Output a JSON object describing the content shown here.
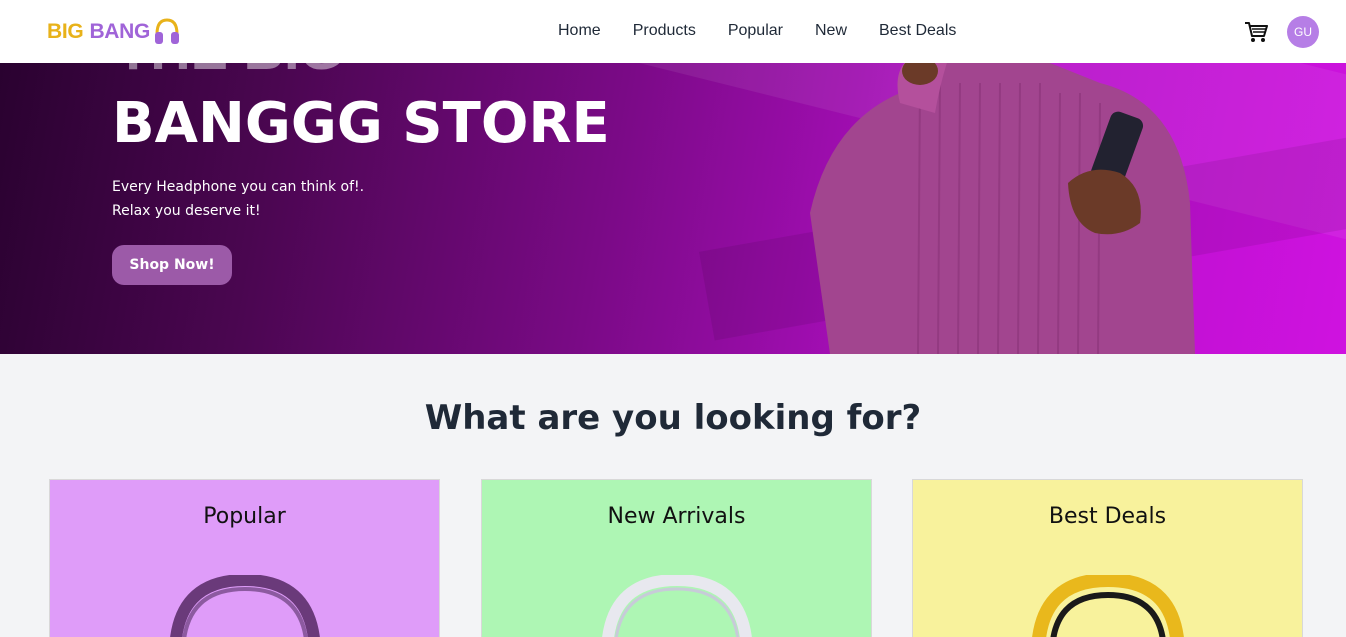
{
  "logo": {
    "part1": "BIG",
    "part2": "BANG"
  },
  "nav": {
    "links": [
      "Home",
      "Products",
      "Popular",
      "New",
      "Best Deals"
    ],
    "avatar_initials": "GU"
  },
  "hero": {
    "ghost_text": "THE BIG",
    "title": "BANGGG STORE",
    "subtitle_line1": "Every Headphone you can think of!.",
    "subtitle_line2": "Relax you deserve it!",
    "cta_label": "Shop Now!"
  },
  "section": {
    "title": "What are you looking for?",
    "cards": [
      {
        "title": "Popular"
      },
      {
        "title": "New Arrivals"
      },
      {
        "title": "Best Deals"
      }
    ]
  },
  "colors": {
    "accent": "#9c5aa8",
    "popular_bg": "#df9cf9",
    "new_bg": "#aef6b4",
    "best_bg": "#f8f29c"
  }
}
